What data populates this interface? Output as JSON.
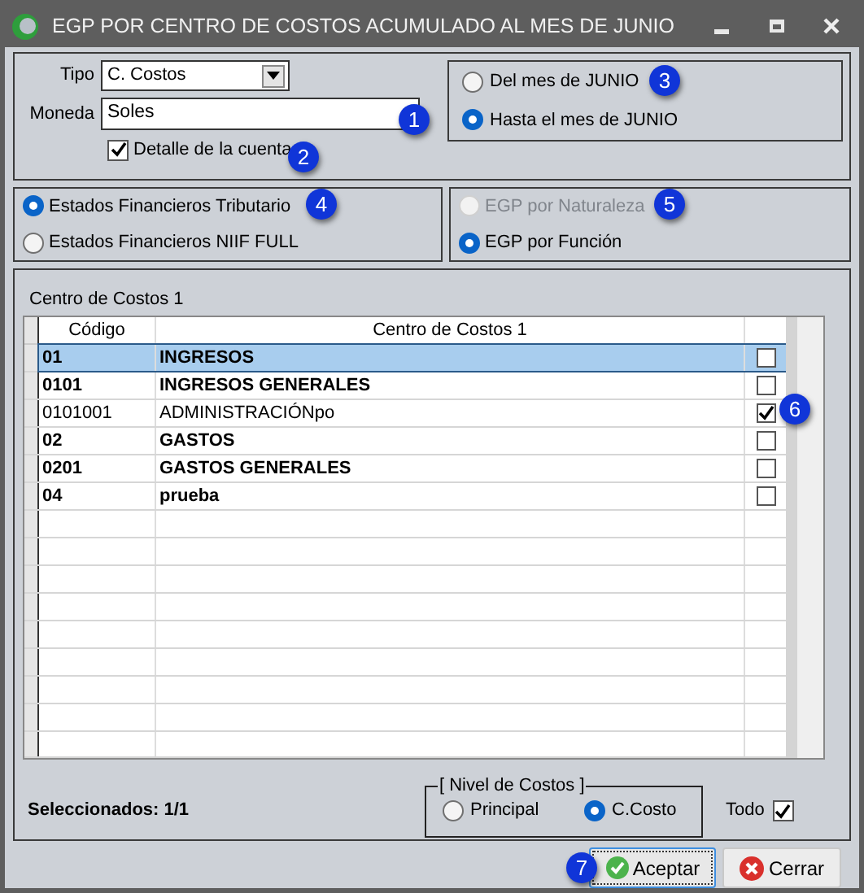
{
  "window": {
    "title": "EGP POR CENTRO DE COSTOS ACUMULADO AL MES DE JUNIO"
  },
  "filters": {
    "tipo": {
      "label": "Tipo",
      "value": "C. Costos"
    },
    "moneda": {
      "label": "Moneda",
      "value": "Soles"
    },
    "detalle": {
      "label": "Detalle de la cuenta",
      "checked": true
    }
  },
  "period": [
    {
      "label": "Del mes de JUNIO",
      "selected": false
    },
    {
      "label": "Hasta el mes de JUNIO",
      "selected": true
    }
  ],
  "statements": [
    {
      "label": "Estados Financieros Tributario",
      "selected": true
    },
    {
      "label": "Estados Financieros NIIF FULL",
      "selected": false
    }
  ],
  "egp": [
    {
      "label": "EGP por Naturaleza",
      "selected": false,
      "disabled": true
    },
    {
      "label": "EGP por Función",
      "selected": true,
      "disabled": false
    }
  ],
  "grid": {
    "title": "Centro de Costos 1",
    "columns": [
      "Código",
      "Centro de Costos 1"
    ],
    "rows": [
      {
        "code": "01",
        "name": "INGRESOS",
        "bold": true,
        "selected": true,
        "checked": false
      },
      {
        "code": "0101",
        "name": "INGRESOS GENERALES",
        "bold": true,
        "selected": false,
        "checked": false
      },
      {
        "code": "0101001",
        "name": "ADMINISTRACIÓNpo",
        "bold": false,
        "selected": false,
        "checked": true
      },
      {
        "code": "02",
        "name": "GASTOS",
        "bold": true,
        "selected": false,
        "checked": false
      },
      {
        "code": "0201",
        "name": "GASTOS GENERALES",
        "bold": true,
        "selected": false,
        "checked": false
      },
      {
        "code": "04",
        "name": "prueba",
        "bold": true,
        "selected": false,
        "checked": false
      }
    ]
  },
  "selected_count": "Seleccionados: 1/1",
  "level": {
    "title": "[ Nivel de Costos ]",
    "options": [
      {
        "label": "Principal",
        "selected": false
      },
      {
        "label": "C.Costo",
        "selected": true
      }
    ]
  },
  "all": {
    "label": "Todo",
    "checked": true
  },
  "buttons": [
    {
      "label": "Aceptar",
      "kind": "accept",
      "focused": true
    },
    {
      "label": "Cerrar",
      "kind": "close",
      "focused": false
    }
  ],
  "callouts": [
    "1",
    "2",
    "3",
    "4",
    "5",
    "6",
    "7"
  ]
}
